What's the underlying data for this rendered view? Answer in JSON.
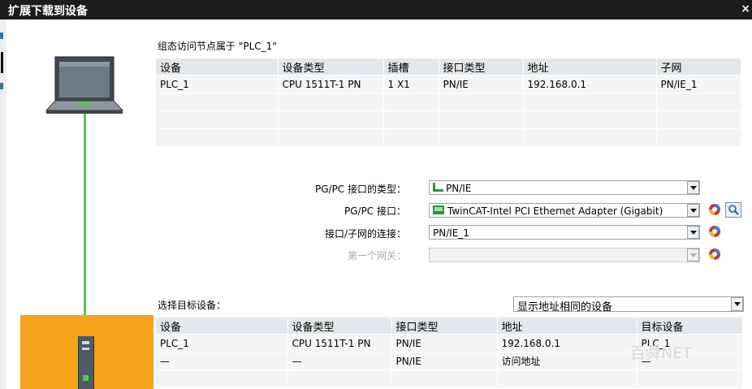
{
  "dialog": {
    "title": "扩展下载到设备",
    "close": "×"
  },
  "config": {
    "caption": "组态访问节点属于 \"PLC_1\"",
    "columns": [
      "设备",
      "设备类型",
      "插槽",
      "接口类型",
      "地址",
      "子网"
    ],
    "rows": [
      [
        "PLC_1",
        "CPU 1511T-1 PN",
        "1 X1",
        "PN/IE",
        "192.168.0.1",
        "PN/IE_1"
      ],
      [
        "",
        "",
        "",
        "",
        "",
        ""
      ],
      [
        "",
        "",
        "",
        "",
        "",
        ""
      ],
      [
        "",
        "",
        "",
        "",
        "",
        ""
      ]
    ]
  },
  "form": {
    "type_label": "PG/PC 接口的类型：",
    "type_value": "PN/IE",
    "iface_label": "PG/PC 接口：",
    "iface_value": "TwinCAT-Intel PCI Ethernet Adapter (Gigabit)",
    "conn_label": "接口/子网的连接：",
    "conn_value": "PN/IE_1",
    "gw_label": "第一个网关：",
    "gw_value": ""
  },
  "target": {
    "label": "选择目标设备：",
    "filter_value": "显示地址相同的设备",
    "columns": [
      "设备",
      "设备类型",
      "接口类型",
      "地址",
      "目标设备"
    ],
    "rows": [
      [
        "PLC_1",
        "CPU 1511T-1 PN",
        "PN/IE",
        "192.168.0.1",
        "PLC_1"
      ],
      [
        "—",
        "—",
        "PN/IE",
        "访问地址",
        "—"
      ],
      [
        "",
        "",
        "",
        "",
        ""
      ]
    ]
  },
  "watermark": "百舜NET",
  "colors": {
    "accent_green": "#55c94f",
    "station_orange": "#f4a31b",
    "title_bg": "#1c1c1c"
  }
}
